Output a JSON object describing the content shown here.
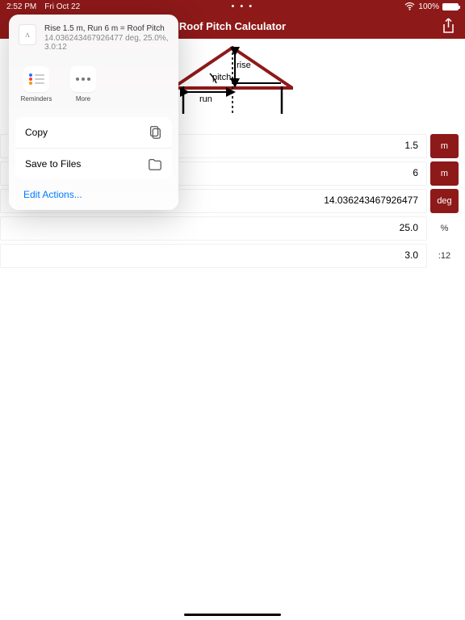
{
  "status": {
    "time": "2:52 PM",
    "date": "Fri Oct 22",
    "dots": "• • •",
    "wifi": "wifi-icon",
    "battery_pct": "100%"
  },
  "nav": {
    "title": "Roof Pitch Calculator"
  },
  "diagram": {
    "labels": {
      "rise": "rise",
      "run": "run",
      "pitch": "pitch"
    }
  },
  "rows": [
    {
      "value": "1.5",
      "unit": "m",
      "unit_interactive": true
    },
    {
      "value": "6",
      "unit": "m",
      "unit_interactive": true
    },
    {
      "value": "14.036243467926477",
      "unit": "deg",
      "unit_interactive": true
    },
    {
      "value": "25.0",
      "unit": "%",
      "unit_interactive": false
    },
    {
      "value": "3.0",
      "unit": ":12",
      "unit_interactive": false
    }
  ],
  "share": {
    "preview_line1": "Rise 1.5 m, Run 6 m = Roof Pitch",
    "preview_line2": "14.036243467926477 deg, 25.0%, 3.0:12",
    "actions": [
      {
        "name": "reminders",
        "label": "Reminders"
      },
      {
        "name": "more",
        "label": "More"
      }
    ],
    "menu": [
      {
        "name": "copy",
        "label": "Copy"
      },
      {
        "name": "save-to-files",
        "label": "Save to Files"
      }
    ],
    "edit": "Edit Actions..."
  }
}
